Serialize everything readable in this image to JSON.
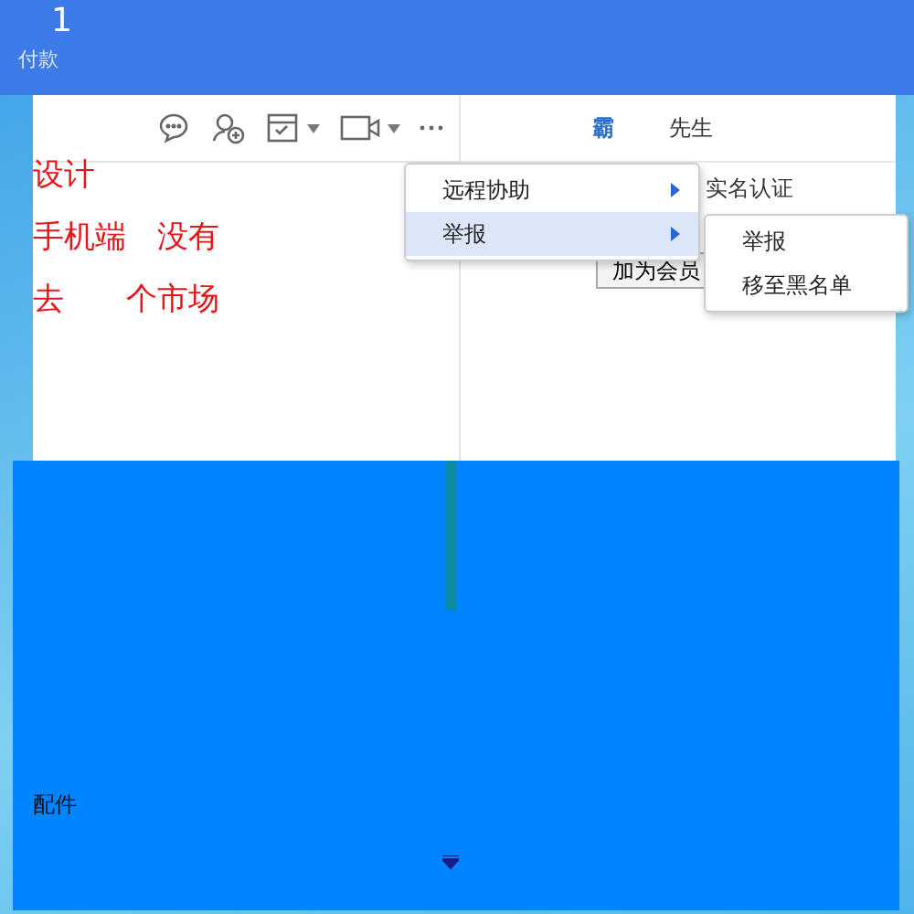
{
  "header": {
    "count": "1",
    "status": "付款"
  },
  "toolbar": [
    {
      "kind": "chat",
      "caret": false
    },
    {
      "kind": "add-contact",
      "caret": false
    },
    {
      "kind": "task",
      "caret": true
    },
    {
      "kind": "video",
      "caret": true
    },
    {
      "kind": "more",
      "caret": false
    }
  ],
  "message_lines": [
    "设计",
    "手机端　没有",
    "去　　个市场"
  ],
  "contact": {
    "name_prefix": "霸",
    "name_suffix": "先生",
    "verification": "实名认证",
    "action": "加为会员"
  },
  "context_menu": {
    "items": [
      {
        "label": "远程协助",
        "selected": false,
        "submenu": true
      },
      {
        "label": "举报",
        "selected": true,
        "submenu": true
      }
    ],
    "submenu": [
      {
        "label": "举报",
        "selected": false
      },
      {
        "label": "移至黑名单",
        "selected": false
      }
    ]
  },
  "lower_panel": {
    "label": "配件"
  }
}
